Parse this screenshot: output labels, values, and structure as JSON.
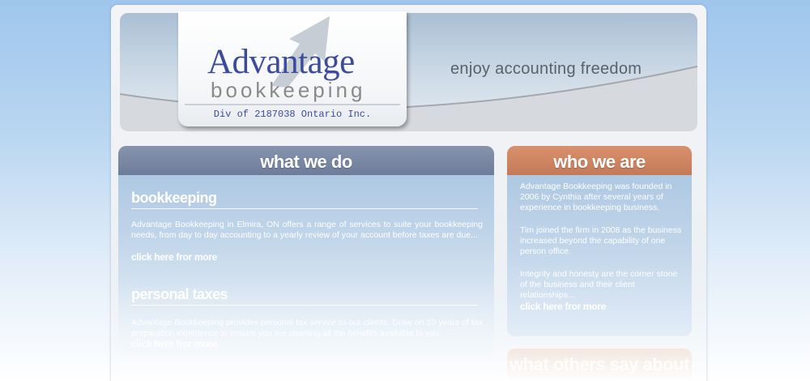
{
  "header": {
    "logo_title": "Advantage",
    "logo_subtitle": "bookkeeping",
    "logo_division": "Div of 2187038 Ontario Inc.",
    "tagline": "enjoy accounting freedom",
    "colors": {
      "brand_blue": "#3c4c9a",
      "header_bg": "#c9d7e4"
    }
  },
  "what_we_do": {
    "heading": "what we do",
    "sections": [
      {
        "title": "bookkeeping",
        "text": "Advantage Bookkeeping in Elmira, ON offers a range of services to suite your bookkeeping needs, from day to day accounting to a yearly review of your account before taxes are due...",
        "link": "click here fror more"
      },
      {
        "title": "personal taxes",
        "text": "Advantage Bookkeeping provides personal tax service to our clients. Draw on 10 years of tax preparation experience to ensure you are claiming all the benefits available to you.",
        "link": "click here fror more"
      }
    ]
  },
  "who_we_are": {
    "heading": "who we are",
    "paragraphs": [
      "Advantage Bookkeeping was founded in 2006 by Cynthia after several years of experience in bookkeeping business.",
      "Tim joined the firm in 2008 as the business increased beyond the capability of one person office.",
      "Integrity and honesty are the corner stone of the business and their client relationships..."
    ],
    "link": "click here fror more",
    "header_color": "#c47a58"
  },
  "what_others_say": {
    "heading": "what others say about us"
  }
}
